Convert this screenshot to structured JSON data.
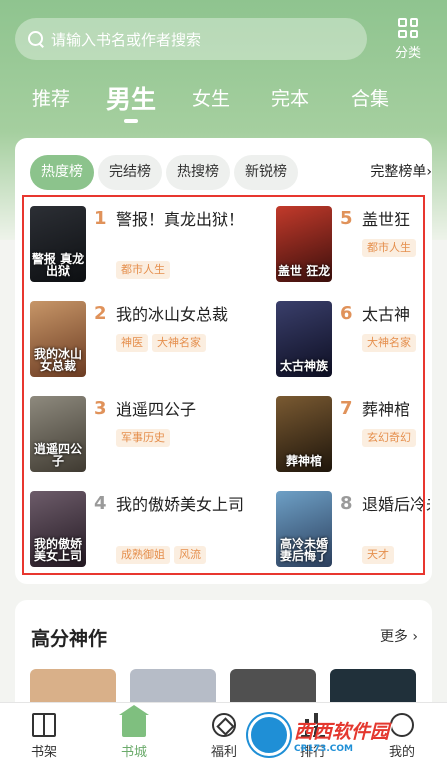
{
  "search": {
    "placeholder": "请输入书名或作者搜索"
  },
  "category_button": {
    "label": "分类",
    "icon": "grid-icon"
  },
  "tabs": [
    {
      "label": "推荐",
      "active": false
    },
    {
      "label": "男生",
      "active": true
    },
    {
      "label": "女生",
      "active": false
    },
    {
      "label": "完本",
      "active": false
    },
    {
      "label": "合集",
      "active": false
    }
  ],
  "ranking": {
    "chips": [
      {
        "label": "热度榜",
        "active": true
      },
      {
        "label": "完结榜",
        "active": false
      },
      {
        "label": "热搜榜",
        "active": false
      },
      {
        "label": "新锐榜",
        "active": false
      }
    ],
    "more_label": "完整榜单",
    "more_icon": "chevron-right-icon",
    "books": [
      {
        "rank": "1",
        "title": "警报！真龙出狱！",
        "tags": [
          "都市人生"
        ],
        "cover_text": "警报 真龙出狱",
        "cover_colors": [
          "#2c2f35",
          "#0d0f12"
        ]
      },
      {
        "rank": "2",
        "title": "我的冰山女总裁",
        "tags": [
          "神医",
          "大神名家"
        ],
        "cover_text": "我的冰山 女总裁",
        "cover_colors": [
          "#c79668",
          "#6b3b22"
        ]
      },
      {
        "rank": "3",
        "title": "逍遥四公子",
        "tags": [
          "军事历史"
        ],
        "cover_text": "逍遥四公子",
        "cover_colors": [
          "#8e8a7e",
          "#3f3a31"
        ]
      },
      {
        "rank": "4",
        "title": "我的傲娇美女上司",
        "tags": [
          "成熟御姐",
          "风流"
        ],
        "cover_text": "我的傲娇 美女上司",
        "cover_colors": [
          "#6d5c6a",
          "#231922"
        ]
      },
      {
        "rank": "5",
        "title": "盖世狂",
        "tags": [
          "都市人生"
        ],
        "cover_text": "盖世 狂龙",
        "cover_colors": [
          "#c23a2b",
          "#3b0f0c"
        ]
      },
      {
        "rank": "6",
        "title": "太古神",
        "tags": [
          "大神名家"
        ],
        "cover_text": "太古神族",
        "cover_colors": [
          "#3a3f6b",
          "#0d0e22"
        ]
      },
      {
        "rank": "7",
        "title": "葬神棺",
        "tags": [
          "玄幻奇幻"
        ],
        "cover_text": "葬神棺",
        "cover_colors": [
          "#7a5a32",
          "#1e150b"
        ]
      },
      {
        "rank": "8",
        "title": "退婚后冷未婚",
        "tags": [
          "天才"
        ],
        "cover_text": "高冷未婚 妻后悔了",
        "cover_colors": [
          "#6ea0c6",
          "#2b3e5c"
        ]
      }
    ]
  },
  "high_score": {
    "title": "高分神作",
    "more_label": "更多",
    "thumb_colors": [
      "#d9b089",
      "#b6bcc7",
      "#505050",
      "#20303a"
    ]
  },
  "bottom_nav": [
    {
      "label": "书架",
      "icon": "bookshelf-icon",
      "active": false
    },
    {
      "label": "书城",
      "icon": "bookstore-icon",
      "active": true
    },
    {
      "label": "福利",
      "icon": "welfare-icon",
      "active": false
    },
    {
      "label": "排行",
      "icon": "ranking-icon",
      "active": false
    },
    {
      "label": "我的",
      "icon": "profile-icon",
      "active": false
    }
  ],
  "watermark": {
    "main": "西西软件园",
    "sub": "CR173.COM"
  }
}
